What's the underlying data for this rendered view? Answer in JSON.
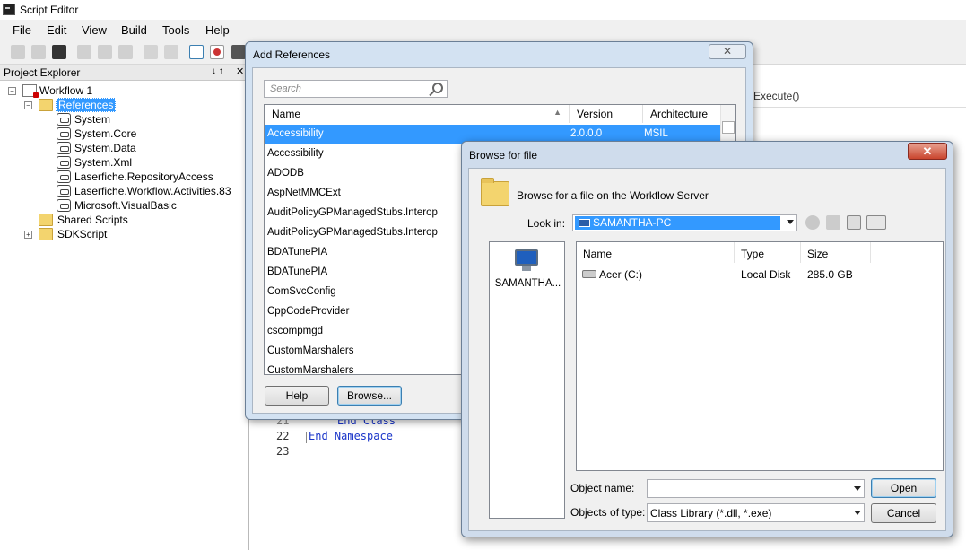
{
  "window": {
    "title": "Script Editor"
  },
  "menu": [
    "File",
    "Edit",
    "View",
    "Build",
    "Tools",
    "Help"
  ],
  "project_explorer": {
    "title": "Project Explorer",
    "pin": "↓ ↑",
    "close": "✕",
    "root": "Workflow 1",
    "references_label": "References",
    "references": [
      "System",
      "System.Core",
      "System.Data",
      "System.Xml",
      "Laserfiche.RepositoryAccess",
      "Laserfiche.Workflow.Activities.83",
      "Microsoft.VisualBasic"
    ],
    "shared_scripts": "Shared Scripts",
    "sdk_script": "SDKScript"
  },
  "editor": {
    "method_combo": "Execute()",
    "line_numbers": [
      "21",
      "22",
      "23"
    ],
    "lines": [
      "End Class",
      "End Namespace",
      ""
    ]
  },
  "add_references": {
    "title": "Add References",
    "close": "✕",
    "search_placeholder": "Search",
    "columns": {
      "name": "Name",
      "version": "Version",
      "architecture": "Architecture"
    },
    "rows": [
      {
        "name": "Accessibility",
        "version": "2.0.0.0",
        "arch": "MSIL",
        "selected": true
      },
      {
        "name": "Accessibility",
        "version": "",
        "arch": ""
      },
      {
        "name": "ADODB",
        "version": "",
        "arch": ""
      },
      {
        "name": "AspNetMMCExt",
        "version": "",
        "arch": ""
      },
      {
        "name": "AuditPolicyGPManagedStubs.Interop",
        "version": "",
        "arch": ""
      },
      {
        "name": "AuditPolicyGPManagedStubs.Interop",
        "version": "",
        "arch": ""
      },
      {
        "name": "BDATunePIA",
        "version": "",
        "arch": ""
      },
      {
        "name": "BDATunePIA",
        "version": "",
        "arch": ""
      },
      {
        "name": "ComSvcConfig",
        "version": "",
        "arch": ""
      },
      {
        "name": "CppCodeProvider",
        "version": "",
        "arch": ""
      },
      {
        "name": "cscompmgd",
        "version": "",
        "arch": ""
      },
      {
        "name": "CustomMarshalers",
        "version": "",
        "arch": ""
      },
      {
        "name": "CustomMarshalers",
        "version": "",
        "arch": ""
      }
    ],
    "help_label": "Help",
    "browse_label": "Browse..."
  },
  "browse_dialog": {
    "title": "Browse for file",
    "close": "✕",
    "heading": "Browse for a file on the Workflow Server",
    "look_in_label": "Look in:",
    "look_in_value": "SAMANTHA-PC",
    "place_label": "SAMANTHA...",
    "columns": {
      "name": "Name",
      "type": "Type",
      "size": "Size"
    },
    "files": [
      {
        "name": "Acer (C:)",
        "type": "Local Disk",
        "size": "285.0 GB"
      }
    ],
    "object_name_label": "Object name:",
    "object_name_value": "",
    "objects_of_type_label": "Objects of type:",
    "objects_of_type_value": "Class Library (*.dll, *.exe)",
    "open_label": "Open",
    "cancel_label": "Cancel"
  }
}
